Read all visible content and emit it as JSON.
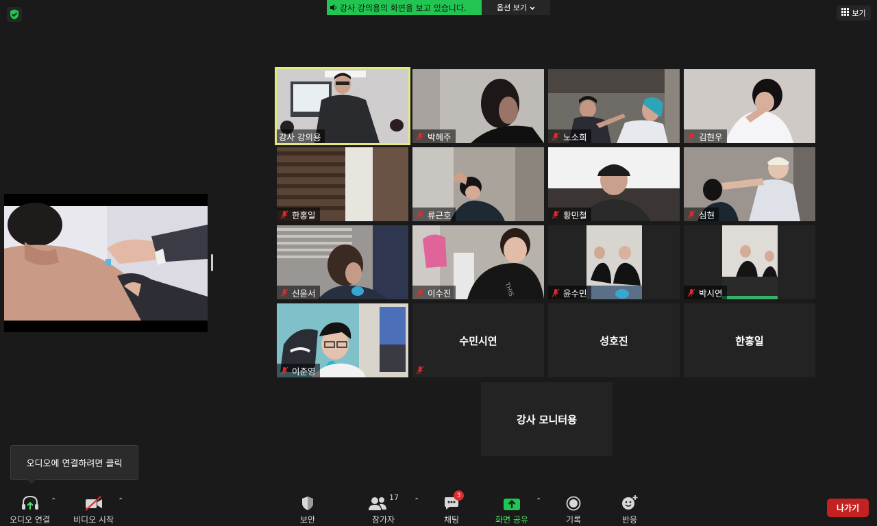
{
  "top": {
    "share_banner": "강사 강의용의 화면을 보고 있습니다.",
    "options_label": "옵션 보기",
    "view_label": "보기",
    "security_badge_color": "#23c552"
  },
  "gallery": {
    "tiles": [
      {
        "name": "강사 강의용",
        "video": true,
        "muted": false,
        "active": true
      },
      {
        "name": "박혜주",
        "video": true,
        "muted": true
      },
      {
        "name": "노소희",
        "video": true,
        "muted": true
      },
      {
        "name": "김현우",
        "video": true,
        "muted": true
      },
      {
        "name": "한홍일",
        "video": true,
        "muted": true
      },
      {
        "name": "류근호",
        "video": true,
        "muted": true
      },
      {
        "name": "황민철",
        "video": true,
        "muted": true
      },
      {
        "name": "심현",
        "video": true,
        "muted": true
      },
      {
        "name": "신윤서",
        "video": true,
        "muted": true
      },
      {
        "name": "이수진",
        "video": true,
        "muted": true
      },
      {
        "name": "윤수민",
        "video": true,
        "muted": true
      },
      {
        "name": "박시연",
        "video": true,
        "muted": true
      },
      {
        "name": "이준영",
        "video": true,
        "muted": true
      },
      {
        "name": "수민시연",
        "video": false,
        "muted": true
      },
      {
        "name": "성호진",
        "video": false,
        "muted": false
      },
      {
        "name": "한홍일",
        "video": false,
        "muted": false
      },
      {
        "name": "강사 모니터용",
        "video": false,
        "muted": false
      }
    ]
  },
  "tooltip": {
    "audio_hint": "오디오에 연결하려면 클릭"
  },
  "toolbar": {
    "audio_label": "오디오 연결",
    "video_label": "비디오 시작",
    "security_label": "보안",
    "participants_label": "참가자",
    "participants_count": "17",
    "chat_label": "채팅",
    "chat_badge": "3",
    "share_label": "화면 공유",
    "record_label": "기록",
    "reactions_label": "반응",
    "leave_label": "나가기"
  },
  "colors": {
    "accent_green": "#23c552",
    "active_speaker": "#e6e680",
    "leave_red": "#c42222",
    "background": "#1a1a1a"
  }
}
